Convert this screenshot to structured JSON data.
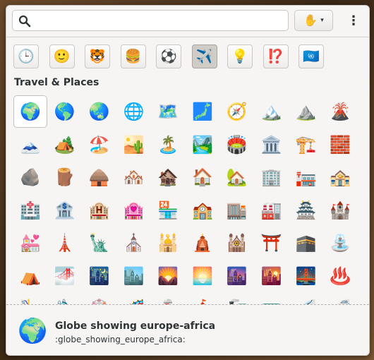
{
  "search": {
    "value": "",
    "placeholder": ""
  },
  "skin_tone": {
    "emoji": "✋",
    "caret": "▾"
  },
  "menu": {
    "label": "⋮"
  },
  "categories": [
    {
      "name": "recent",
      "emoji": "🕒"
    },
    {
      "name": "smileys",
      "emoji": "🙂"
    },
    {
      "name": "animals",
      "emoji": "🐯"
    },
    {
      "name": "food",
      "emoji": "🍔"
    },
    {
      "name": "activities",
      "emoji": "⚽"
    },
    {
      "name": "travel",
      "emoji": "✈️",
      "active": true
    },
    {
      "name": "objects",
      "emoji": "💡"
    },
    {
      "name": "symbols",
      "emoji": "⁉️"
    },
    {
      "name": "flags",
      "emoji": "🇺🇳"
    }
  ],
  "section_title": "Travel & Places",
  "emoji_grid": [
    [
      "🌍",
      "🌎",
      "🌏",
      "🌐",
      "🗺️",
      "🗾",
      "🧭",
      "🏔️",
      "⛰️",
      "🌋"
    ],
    [
      "🗻",
      "🏕️",
      "🏖️",
      "🏜️",
      "🏝️",
      "🏞️",
      "🏟️",
      "🏛️",
      "🏗️",
      "🧱"
    ],
    [
      "🪨",
      "🪵",
      "🛖",
      "🏘️",
      "🏚️",
      "🏠",
      "🏡",
      "🏢",
      "🏣",
      "🏤"
    ],
    [
      "🏥",
      "🏦",
      "🏨",
      "🏩",
      "🏪",
      "🏫",
      "🏬",
      "🏭",
      "🏯",
      "🏰"
    ],
    [
      "💒",
      "🗼",
      "🗽",
      "⛪",
      "🕌",
      "🛕",
      "🕍",
      "⛩️",
      "🕋",
      "⛲"
    ],
    [
      "⛺",
      "🌁",
      "🌃",
      "🏙️",
      "🌄",
      "🌅",
      "🌆",
      "🌇",
      "🌉",
      "♨️"
    ],
    [
      "🎠",
      "🛝",
      "🎡",
      "🎢",
      "💈",
      "🎪",
      "🚂",
      "🚃",
      "🚄",
      "🚅"
    ]
  ],
  "selected": {
    "row": 0,
    "col": 0
  },
  "footer": {
    "emoji": "🌍",
    "name": "Globe showing europe-africa",
    "code": ":globe_showing_europe_africa:"
  }
}
